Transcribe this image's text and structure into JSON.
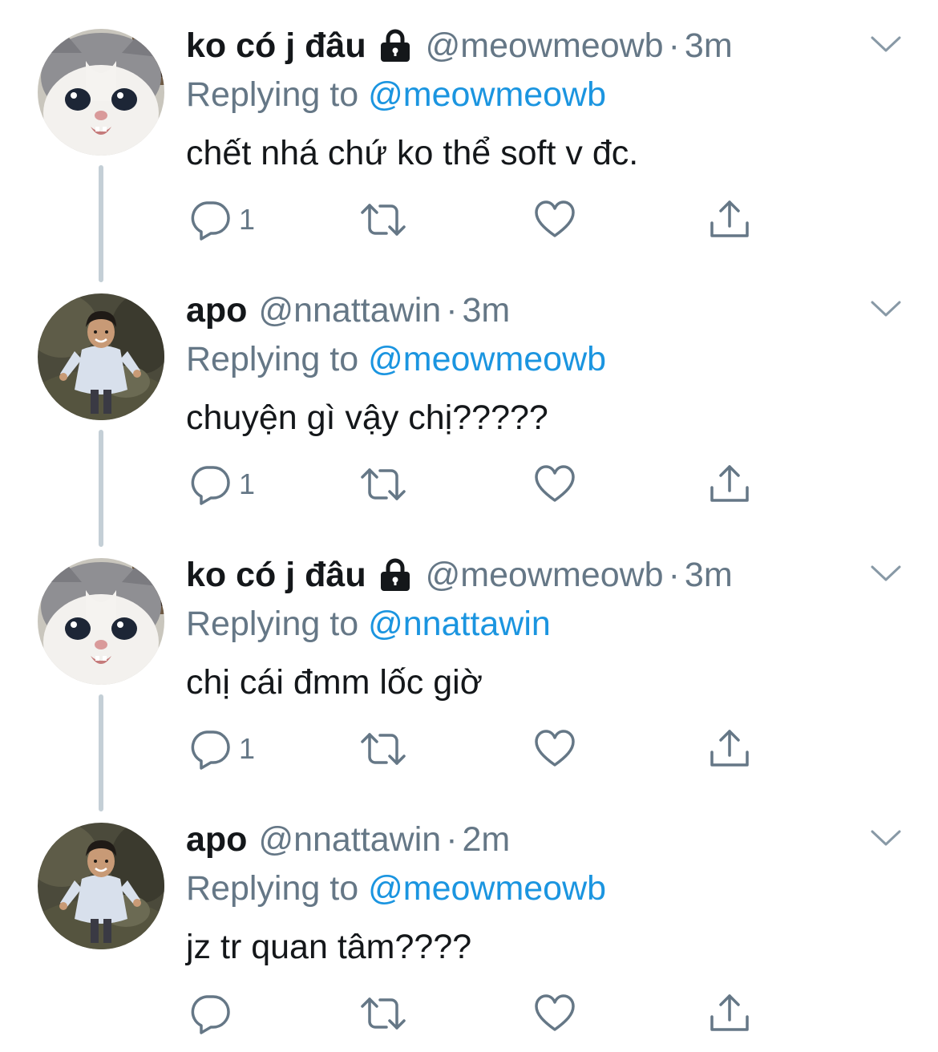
{
  "colors": {
    "primary_text": "#14171a",
    "secondary_text": "#657786",
    "link": "#1b95e0",
    "thread_line": "#c4cfd6",
    "icon": "#657786"
  },
  "tweets": [
    {
      "display_name": "ko có j đâu",
      "protected": true,
      "handle": "@meowmeowb",
      "separator": "·",
      "time": "3m",
      "replying_prefix": "Replying to",
      "replying_to": "@meowmeowb",
      "text": "chết nhá chứ ko thể soft v đc.",
      "reply_count": "1",
      "avatar": "cat-avatar"
    },
    {
      "display_name": "apo",
      "protected": false,
      "handle": "@nnattawin",
      "separator": "·",
      "time": "3m",
      "replying_prefix": "Replying to",
      "replying_to": "@meowmeowb",
      "text": "chuyện gì vậy chị?????",
      "reply_count": "1",
      "avatar": "person-avatar"
    },
    {
      "display_name": "ko có j đâu",
      "protected": true,
      "handle": "@meowmeowb",
      "separator": "·",
      "time": "3m",
      "replying_prefix": "Replying to",
      "replying_to": "@nnattawin",
      "text": "chị cái đmm lốc giờ",
      "reply_count": "1",
      "avatar": "cat-avatar"
    },
    {
      "display_name": "apo",
      "protected": false,
      "handle": "@nnattawin",
      "separator": "·",
      "time": "2m",
      "replying_prefix": "Replying to",
      "replying_to": "@meowmeowb",
      "text": "jz tr quan tâm????",
      "reply_count": "",
      "avatar": "person-avatar"
    }
  ],
  "icons": {
    "lock": "lock-icon",
    "more": "chevron-down-icon",
    "reply": "reply-icon",
    "retweet": "retweet-icon",
    "like": "like-icon",
    "share": "share-icon"
  }
}
